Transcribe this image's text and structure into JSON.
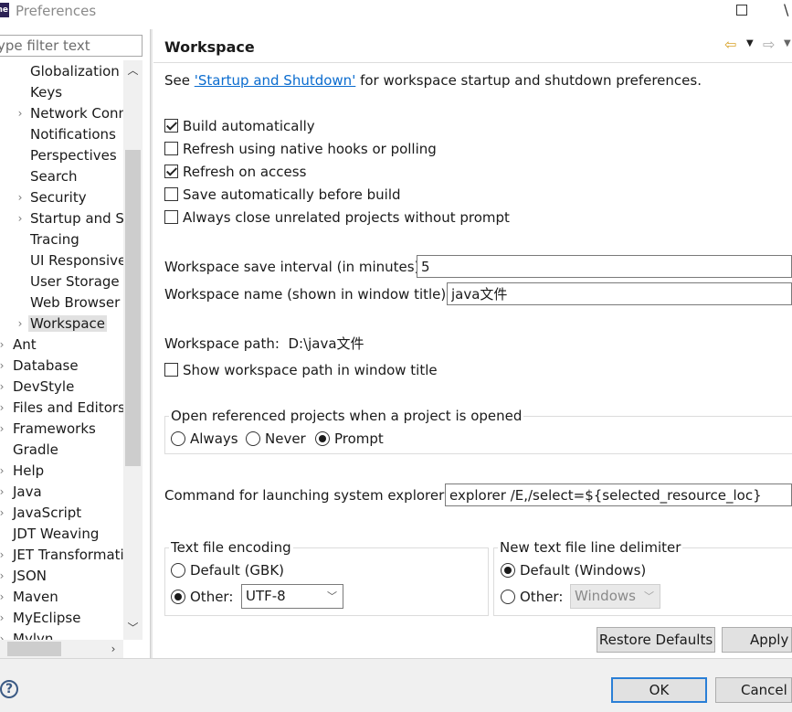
{
  "window": {
    "logo_text": "ne",
    "title": "Preferences"
  },
  "sidebar": {
    "filter_placeholder": "ype filter text",
    "items": [
      {
        "label": "Globalization",
        "level": 1,
        "expandable": false
      },
      {
        "label": "Keys",
        "level": 1,
        "expandable": false
      },
      {
        "label": "Network Conn",
        "level": 1,
        "expandable": true
      },
      {
        "label": "Notifications",
        "level": 1,
        "expandable": false
      },
      {
        "label": "Perspectives",
        "level": 1,
        "expandable": false
      },
      {
        "label": "Search",
        "level": 1,
        "expandable": false
      },
      {
        "label": "Security",
        "level": 1,
        "expandable": true
      },
      {
        "label": "Startup and Sh",
        "level": 1,
        "expandable": true
      },
      {
        "label": "Tracing",
        "level": 1,
        "expandable": false
      },
      {
        "label": "UI Responsive",
        "level": 1,
        "expandable": false
      },
      {
        "label": "User Storage S",
        "level": 1,
        "expandable": false
      },
      {
        "label": "Web Browser",
        "level": 1,
        "expandable": false
      },
      {
        "label": "Workspace",
        "level": 1,
        "expandable": true,
        "selected": true
      },
      {
        "label": "Ant",
        "level": 0,
        "expandable": true
      },
      {
        "label": "Database",
        "level": 0,
        "expandable": true
      },
      {
        "label": "DevStyle",
        "level": 0,
        "expandable": true
      },
      {
        "label": "Files and Editors",
        "level": 0,
        "expandable": true
      },
      {
        "label": "Frameworks",
        "level": 0,
        "expandable": true
      },
      {
        "label": "Gradle",
        "level": 0,
        "expandable": false
      },
      {
        "label": "Help",
        "level": 0,
        "expandable": true
      },
      {
        "label": "Java",
        "level": 0,
        "expandable": true
      },
      {
        "label": "JavaScript",
        "level": 0,
        "expandable": true
      },
      {
        "label": "JDT Weaving",
        "level": 0,
        "expandable": false
      },
      {
        "label": "JET Transformati",
        "level": 0,
        "expandable": true
      },
      {
        "label": "JSON",
        "level": 0,
        "expandable": true
      },
      {
        "label": "Maven",
        "level": 0,
        "expandable": true
      },
      {
        "label": "MyEclipse",
        "level": 0,
        "expandable": true
      },
      {
        "label": "Mylyn",
        "level": 0,
        "expandable": true
      }
    ]
  },
  "page": {
    "title": "Workspace",
    "see_prefix": "See ",
    "see_link": "'Startup and Shutdown'",
    "see_suffix": " for workspace startup and shutdown preferences.",
    "checks": [
      {
        "label": "Build automatically",
        "checked": true
      },
      {
        "label": "Refresh using native hooks or polling",
        "checked": false
      },
      {
        "label": "Refresh on access",
        "checked": true
      },
      {
        "label": "Save automatically before build",
        "checked": false
      },
      {
        "label": "Always close unrelated projects without prompt",
        "checked": false
      }
    ],
    "save_interval_label": "Workspace save interval (in minutes):",
    "save_interval_value": "5",
    "workspace_name_label": "Workspace name (shown in window title):",
    "workspace_name_value": "java文件",
    "workspace_path_label": "Workspace path:",
    "workspace_path_value": "D:\\java文件",
    "show_path_label": "Show workspace path in window title",
    "show_path_checked": false,
    "open_ref_group": {
      "title": "Open referenced projects when a project is opened",
      "options": [
        {
          "label": "Always",
          "selected": false
        },
        {
          "label": "Never",
          "selected": false
        },
        {
          "label": "Prompt",
          "selected": true
        }
      ]
    },
    "explorer_label": "Command for launching system explorer:",
    "explorer_value": "explorer /E,/select=${selected_resource_loc}",
    "encoding_group": {
      "title": "Text file encoding",
      "default_label": "Default (GBK)",
      "other_label": "Other:",
      "other_selected": true,
      "other_value": "UTF-8"
    },
    "delimiter_group": {
      "title": "New text file line delimiter",
      "default_label": "Default (Windows)",
      "default_selected": true,
      "other_label": "Other:",
      "other_value": "Windows"
    },
    "restore_defaults_label": "Restore Defaults",
    "apply_label": "Apply"
  },
  "footer": {
    "ok_label": "OK",
    "cancel_label": "Cancel"
  }
}
